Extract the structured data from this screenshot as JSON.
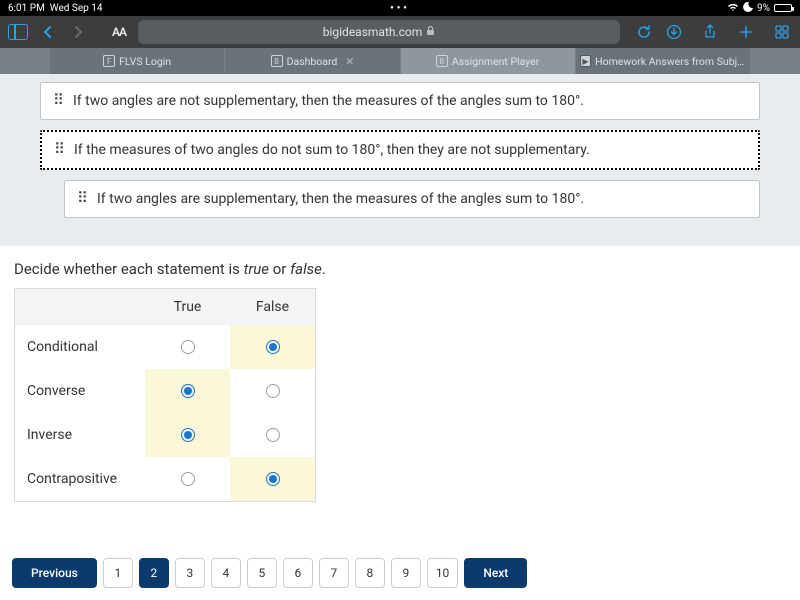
{
  "status": {
    "time": "6:01 PM",
    "date": "Wed Sep 14",
    "battery": "9%"
  },
  "browser": {
    "aa": "AA",
    "url": "bigideasmath.com",
    "tabs": [
      {
        "label": "FLVS Login",
        "badge": "F"
      },
      {
        "label": "Dashboard",
        "badge": "B",
        "closable": true
      },
      {
        "label": "Assignment Player",
        "badge": "B",
        "active": true
      },
      {
        "label": "Homework Answers from Subjec...",
        "badge": "▶"
      }
    ]
  },
  "statements": [
    "If two angles are not supplementary, then the measures of the angles sum to 180°.",
    "If the measures of two angles do not sum to 180°, then they are not supplementary.",
    "If two angles are supplementary, then the measures of the angles sum to 180°."
  ],
  "prompt_a": "Decide whether each statement is ",
  "prompt_b": "true",
  "prompt_c": " or ",
  "prompt_d": "false",
  "prompt_e": ".",
  "table": {
    "header_true": "True",
    "header_false": "False",
    "rows": [
      {
        "label": "Conditional",
        "sel": "false"
      },
      {
        "label": "Converse",
        "sel": "true"
      },
      {
        "label": "Inverse",
        "sel": "true"
      },
      {
        "label": "Contrapositive",
        "sel": "false"
      }
    ]
  },
  "pager": {
    "prev": "Previous",
    "next": "Next",
    "pages": [
      "1",
      "2",
      "3",
      "4",
      "5",
      "6",
      "7",
      "8",
      "9",
      "10"
    ],
    "current": "2"
  }
}
